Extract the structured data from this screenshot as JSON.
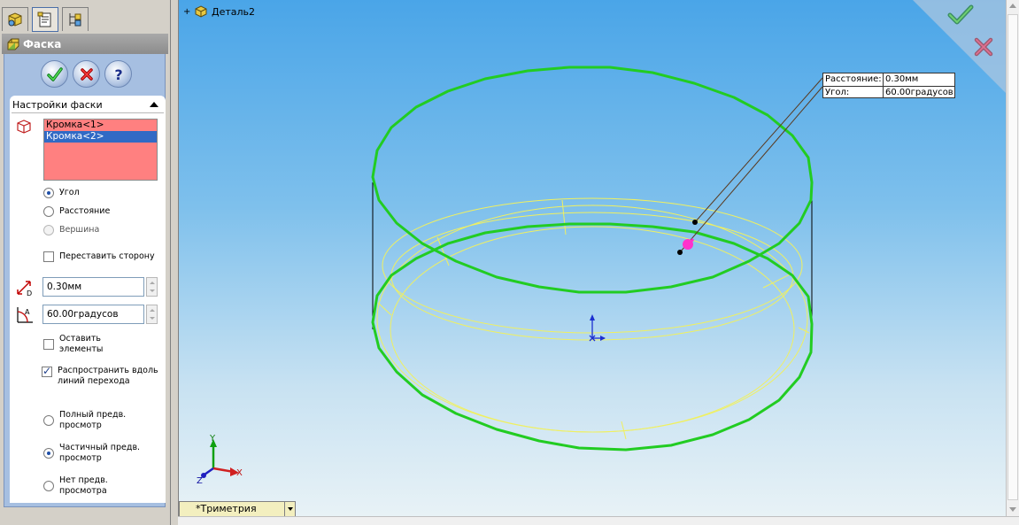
{
  "colors": {
    "panel_bg": "#a6bfe1",
    "edge_list_bg": "#ff8080",
    "model_green": "#22cc22",
    "model_yellow": "#f0f060",
    "handle_magenta": "#ff33cc"
  },
  "tabs": [
    {
      "icon": "feature-manager-icon"
    },
    {
      "icon": "property-manager-icon"
    },
    {
      "icon": "configuration-manager-icon"
    }
  ],
  "property_manager": {
    "title": "Фаска",
    "title_icon": "chamfer-icon",
    "ok_icon": "ok-check-icon",
    "cancel_icon": "cancel-x-icon",
    "help_icon": "help-question-icon"
  },
  "chamfer_settings": {
    "group_title": "Настройки фаски",
    "edges": [
      "Кромка<1>",
      "Кромка<2>"
    ],
    "selected_edge_index": 1,
    "type_options": [
      {
        "label": "Угол",
        "selected": true,
        "enabled": true
      },
      {
        "label": "Расстояние",
        "selected": false,
        "enabled": true
      },
      {
        "label": "Вершина",
        "selected": false,
        "enabled": false
      }
    ],
    "flip_direction": {
      "label": "Переставить сторону",
      "checked": false
    },
    "distance_value": "0.30мм",
    "angle_value": "60.00градусов",
    "keep_features": {
      "label_line1": "Оставить",
      "label_line2": "элементы",
      "checked": false
    },
    "tangent_propagation": {
      "label_line1": "Распространить вдоль",
      "label_line2": "линий перехода",
      "checked": true
    },
    "preview_options": [
      {
        "label_line1": "Полный предв.",
        "label_line2": "просмотр",
        "selected": false
      },
      {
        "label_line1": "Частичный предв.",
        "label_line2": "просмотр",
        "selected": true
      },
      {
        "label_line1": "Нет предв.",
        "label_line2": "просмотра",
        "selected": false
      }
    ]
  },
  "viewport": {
    "tree_expand": "+",
    "part_name": "Деталь2",
    "callout": {
      "distance_label": "Расстояние:",
      "distance_value": "0.30мм",
      "angle_label": "Угол:",
      "angle_value": "60.00градусов"
    },
    "triad": {
      "x": "X",
      "y": "Y",
      "z": "Z"
    },
    "view_orientation": "*Триметрия",
    "confirm_icons": [
      "ok-check-icon",
      "cancel-x-icon"
    ]
  }
}
